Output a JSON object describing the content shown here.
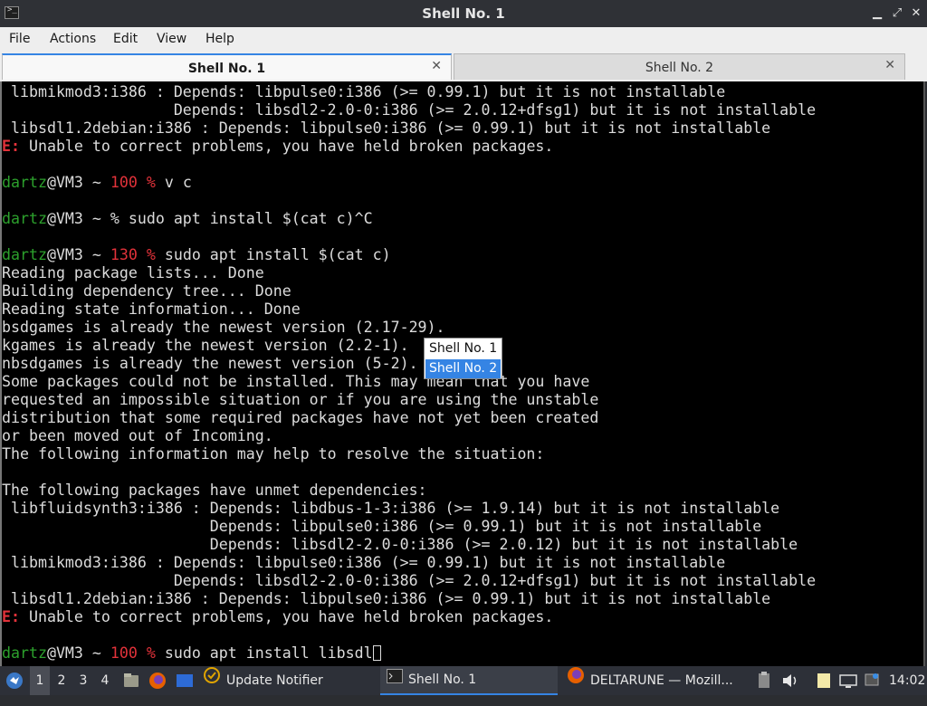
{
  "window": {
    "title": "Shell No. 1",
    "app_icon_glyph": ">_",
    "minimize_glyph": "▁",
    "maximize_glyph": "⤢",
    "close_glyph": "✕"
  },
  "menu": [
    "File",
    "Actions",
    "Edit",
    "View",
    "Help"
  ],
  "tabs": [
    {
      "label": "Shell No. 1",
      "close": "✕",
      "active": true
    },
    {
      "label": "Shell No. 2",
      "close": "✕",
      "active": false
    }
  ],
  "terminal": {
    "lines": [
      " libmikmod3:i386 : Depends: libpulse0:i386 (>= 0.99.1) but it is not installable",
      "                   Depends: libsdl2-2.0-0:i386 (>= 2.0.12+dfsg1) but it is not installable",
      " libsdl1.2debian:i386 : Depends: libpulse0:i386 (>= 0.99.1) but it is not installable",
      "E: Unable to correct problems, you have held broken packages.",
      "",
      "dartz@VM3 ~ 100 % v c",
      "",
      "dartz@VM3 ~ % sudo apt install $(cat c)^C",
      "",
      "dartz@VM3 ~ 130 % sudo apt install $(cat c)",
      "Reading package lists... Done",
      "Building dependency tree... Done",
      "Reading state information... Done",
      "bsdgames is already the newest version (2.17-29).",
      "kgames is already the newest version (2.2-1).",
      "nbsdgames is already the newest version (5-2).",
      "Some packages could not be installed. This may mean that you have",
      "requested an impossible situation or if you are using the unstable",
      "distribution that some required packages have not yet been created",
      "or been moved out of Incoming.",
      "The following information may help to resolve the situation:",
      "",
      "The following packages have unmet dependencies:",
      " libfluidsynth3:i386 : Depends: libdbus-1-3:i386 (>= 1.9.14) but it is not installable",
      "                       Depends: libpulse0:i386 (>= 0.99.1) but it is not installable",
      "                       Depends: libsdl2-2.0-0:i386 (>= 2.0.12) but it is not installable",
      " libmikmod3:i386 : Depends: libpulse0:i386 (>= 0.99.1) but it is not installable",
      "                   Depends: libsdl2-2.0-0:i386 (>= 2.0.12+dfsg1) but it is not installable",
      " libsdl1.2debian:i386 : Depends: libpulse0:i386 (>= 0.99.1) but it is not installable",
      "E: Unable to correct problems, you have held broken packages.",
      "",
      "dartz@VM3 ~ 100 % sudo apt install libsdl"
    ],
    "cursor_after_last_line": true
  },
  "popup": {
    "items": [
      "Shell No. 1",
      "Shell No. 2"
    ],
    "selected": "Shell No. 2"
  },
  "taskbar": {
    "workspaces": [
      "1",
      "2",
      "3",
      "4"
    ],
    "active_workspace": "1",
    "launchers": [
      "start-menu-icon",
      "file-manager-icon",
      "firefox-icon",
      "show-desktop-icon"
    ],
    "tasks": [
      {
        "label": "Update Notifier",
        "icon": "update-notifier-icon"
      },
      {
        "label": "Shell No. 1",
        "icon": "terminal-icon",
        "active": true
      },
      {
        "label": "DELTARUNE — Mozill...",
        "icon": "firefox-icon"
      }
    ],
    "tray": [
      "clipboard-icon",
      "volume-icon",
      "notes-icon",
      "display-icon",
      "network-icon"
    ],
    "clock": "14:02"
  },
  "colors": {
    "prompt_user": "#2ca02c",
    "prompt_error_status": "#e2323a",
    "terminal_bg": "#000000",
    "terminal_fg": "#dcdcdc",
    "selection": "#3584e4"
  }
}
